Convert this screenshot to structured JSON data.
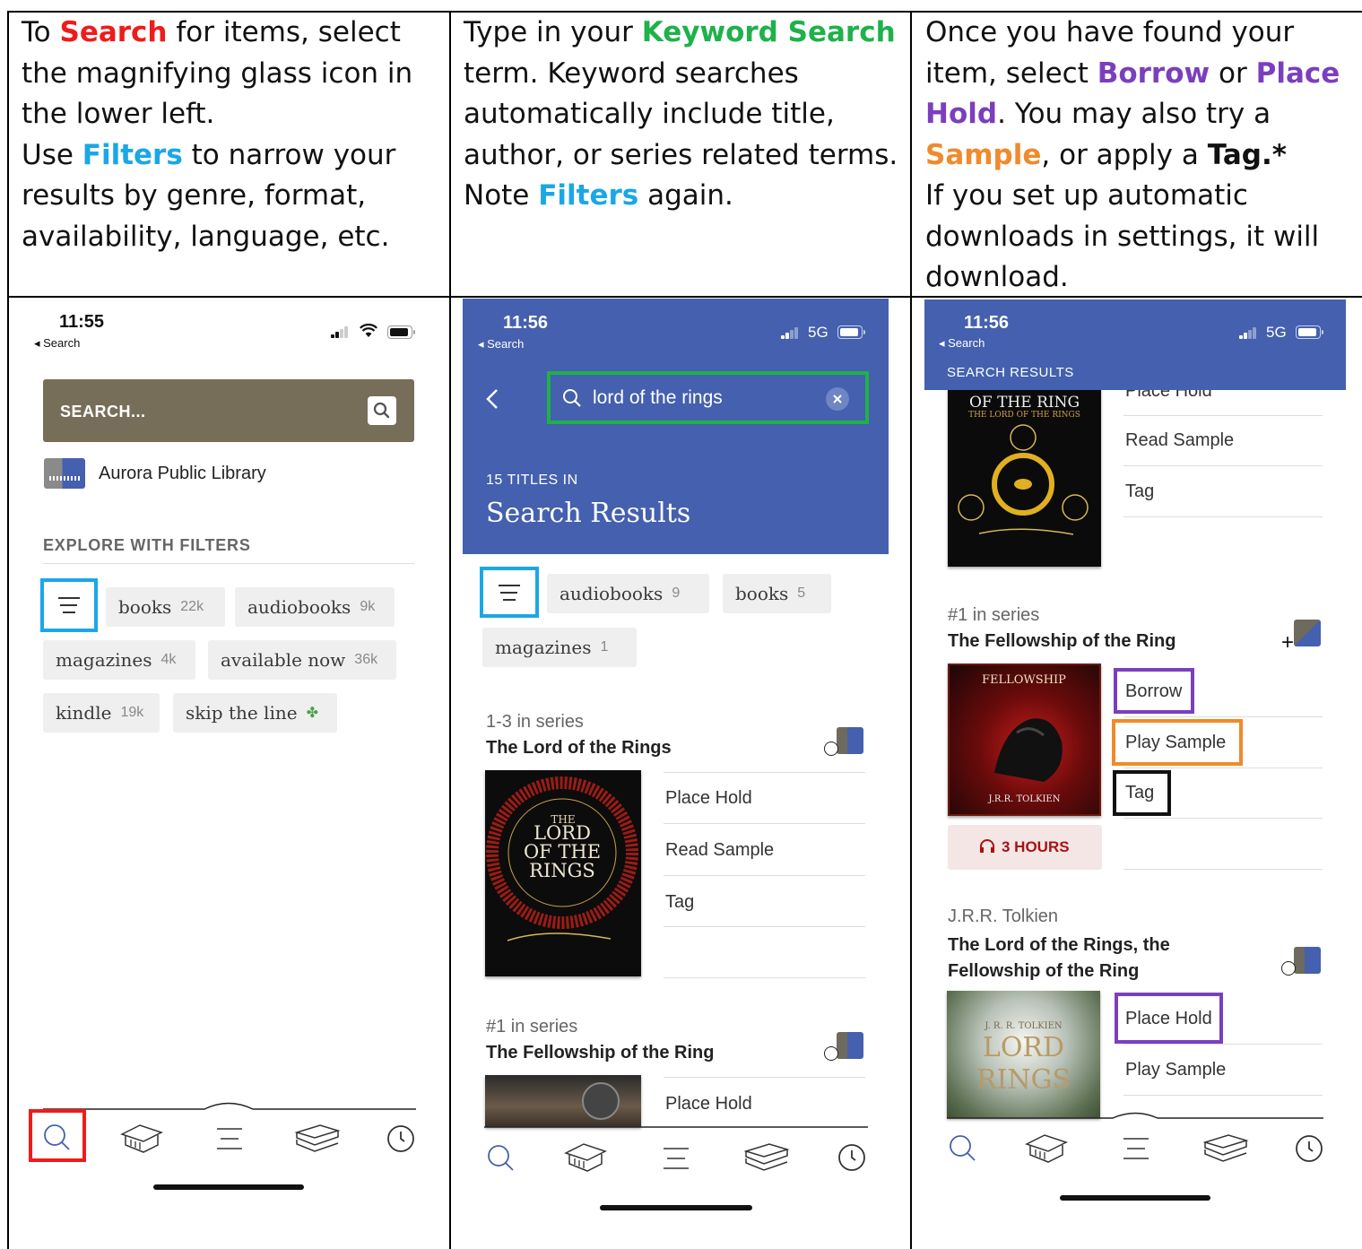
{
  "instructions": {
    "col1": {
      "p1_a": "To ",
      "p1_search": "Search",
      "p1_b": " for items, select the magnifying glass icon in the lower left.",
      "p2_a": "Use ",
      "p2_filters": "Filters",
      "p2_b": " to narrow your results by genre, format, availability, language, etc."
    },
    "col2": {
      "p1_a": "Type in your ",
      "p1_keyword": "Keyword Search",
      "p1_b": " term. Keyword searches automatically include title, author, or series related terms.",
      "p2_a": "Note ",
      "p2_filters": "Filters",
      "p2_b": " again."
    },
    "col3": {
      "p1_a": "Once you have found your item, select ",
      "p1_borrow": "Borrow",
      "p1_or": " or ",
      "p1_placehold": "Place Hold",
      "p1_b": ". You may also try a ",
      "p1_sample": "Sample",
      "p1_c": ", or apply a ",
      "p1_tag": "Tag.*",
      "p2": "If you set up automatic downloads in settings, it will download."
    }
  },
  "screen1": {
    "time": "11:55",
    "back": "◂ Search",
    "search_placeholder": "SEARCH...",
    "library_name": "Aurora Public Library",
    "explore_label": "EXPLORE WITH FILTERS",
    "chips": [
      {
        "label": "books",
        "count": "22k"
      },
      {
        "label": "audiobooks",
        "count": "9k"
      },
      {
        "label": "magazines",
        "count": "4k"
      },
      {
        "label": "available now",
        "count": "36k"
      },
      {
        "label": "kindle",
        "count": "19k"
      },
      {
        "label": "skip the line",
        "count": "✤"
      }
    ]
  },
  "screen2": {
    "time": "11:56",
    "back": "◂ Search",
    "network": "5G",
    "query": "lord of the rings",
    "count_label": "15 TITLES IN",
    "heading": "Search Results",
    "chips": [
      {
        "label": "audiobooks",
        "count": "9"
      },
      {
        "label": "books",
        "count": "5"
      },
      {
        "label": "magazines",
        "count": "1"
      }
    ],
    "item1": {
      "series": "1-3 in series",
      "title": "The Lord of the Rings",
      "cover_the": "THE",
      "cover_title": "LORD\nOF THE\nRINGS",
      "actions": [
        "Place Hold",
        "Read Sample",
        "Tag"
      ]
    },
    "item2": {
      "series": "#1 in series",
      "title": "The Fellowship of the Ring",
      "actions": [
        "Place Hold"
      ]
    }
  },
  "screen3": {
    "time": "11:56",
    "back": "◂ Search",
    "network": "5G",
    "header_label": "SEARCH RESULTS",
    "item0": {
      "cover_line1": "OF THE RING",
      "cover_line2": "THE LORD OF THE RINGS",
      "actions": [
        "Place Hold",
        "Read Sample",
        "Tag"
      ]
    },
    "item1": {
      "series": "#1 in series",
      "title": "The Fellowship of the Ring",
      "cover_text": "FELLOWSHIP",
      "cover_author": "J.R.R. TOLKIEN",
      "actions": [
        "Borrow",
        "Play Sample",
        "Tag"
      ],
      "duration": "3 HOURS"
    },
    "item2": {
      "author": "J.R.R. Tolkien",
      "title": "The Lord of the Rings, the Fellowship of the Ring",
      "cover_author": "J. R. R. TOLKIEN",
      "cover_title": "LORD",
      "cover_title2": "RINGS",
      "actions": [
        "Place Hold",
        "Play Sample"
      ]
    }
  },
  "colors": {
    "search_red": "#ee1c1c",
    "filters_blue": "#1aa7e6",
    "keyword_green": "#1fb14a",
    "borrow_purple": "#7b3fbd",
    "sample_orange": "#f08a2b",
    "header_blue": "#4460ae",
    "search_bar_bg": "#776e5a"
  },
  "icons": [
    "search-icon",
    "library-icon",
    "menu-icon",
    "shelf-icon",
    "clock-icon",
    "filter-icon",
    "back-chevron-icon",
    "clear-icon",
    "bookmark-icon",
    "headphones-icon"
  ]
}
